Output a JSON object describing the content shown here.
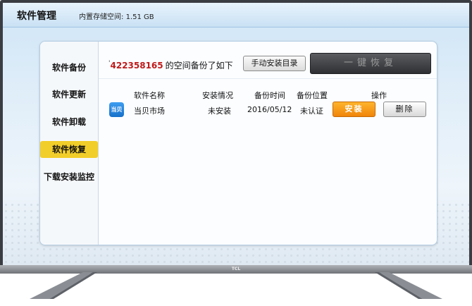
{
  "header": {
    "title": "软件管理",
    "storage_label": "内置存储空间:",
    "storage_value": "1.51 GB"
  },
  "sidebar": {
    "items": [
      {
        "label": "软件备份",
        "active": false
      },
      {
        "label": "软件更新",
        "active": false
      },
      {
        "label": "软件卸载",
        "active": false
      },
      {
        "label": "软件恢复",
        "active": true
      },
      {
        "label": "下载安装监控",
        "active": false
      }
    ]
  },
  "backup": {
    "prefix": "'",
    "account": "422358165",
    "suffix": "的空间备份了如下",
    "manual_button": "手动安装目录",
    "restore_button": "一键恢复"
  },
  "table": {
    "headers": [
      "软件名称",
      "安装情况",
      "备份时间",
      "备份位置",
      "操作"
    ],
    "rows": [
      {
        "icon_text": "当贝",
        "name": "当贝市场",
        "status": "未安装",
        "time": "2016/05/12",
        "location": "未认证",
        "install_label": "安装",
        "delete_label": "删除"
      }
    ]
  },
  "tv": {
    "brand": "TCL"
  },
  "colors": {
    "active_nav": "#f2ce2a",
    "account_red": "#c01a1a",
    "install_orange": "#f0850a"
  }
}
